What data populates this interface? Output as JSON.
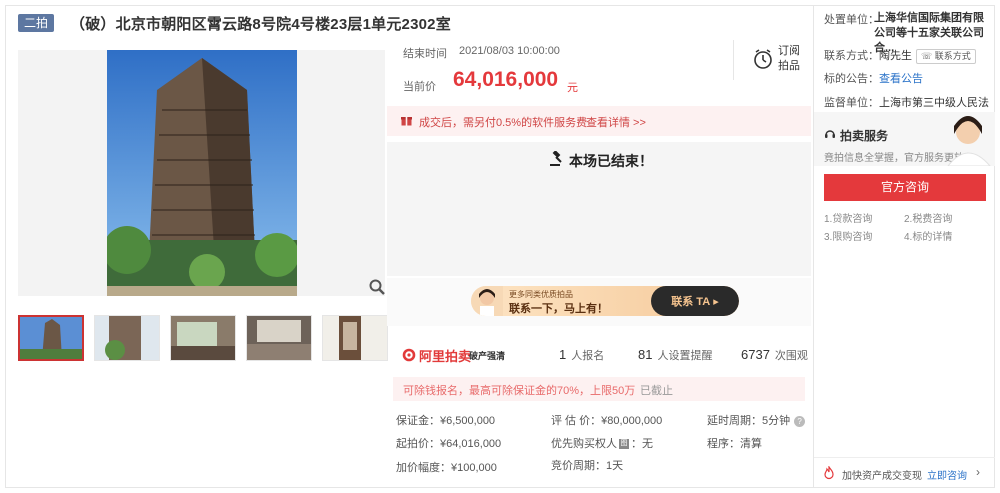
{
  "title": {
    "round_badge": "二拍",
    "text": "（破）北京市朝阳区霄云路8号院4号楼23层1单元2302室"
  },
  "auction": {
    "end_time_label": "结束时间",
    "end_time_value": "2021/08/03 10:00:00",
    "price_label": "当前价",
    "price_value": "64,016,000",
    "price_unit": "元",
    "subscribe_label": "订阅拍品",
    "fee_text": "成交后，需另付0.5%的软件服务费",
    "fee_link": "查看详情 >>",
    "status_text": "本场已结束！"
  },
  "banner": {
    "small_text": "更多同类优质拍品",
    "big_text": "联系一下，马上有！",
    "cta": "联系 TA"
  },
  "stats": {
    "brand": "阿里拍卖",
    "slogan": "破产强清",
    "signup_num": "1",
    "signup_label": "人报名",
    "remind_num": "81",
    "remind_label": "人设置提醒",
    "views_num": "6737",
    "views_label": "次围观",
    "deposit_text": "可除钱报名，最高可除保证金的70%，上限50万",
    "deposit_status": "已截止"
  },
  "details": {
    "deposit": "保证金：¥6,500,000",
    "appraisal": "评 估 价：¥80,000,000",
    "delay": "延时周期：5分钟",
    "start_price": "起拍价：¥64,016,000",
    "priority_prefix": "优先购买权人",
    "priority_icon": "图",
    "priority_value": "：无",
    "procedure": "程序：清算",
    "increment": "加价幅度：¥100,000",
    "bid_period": "竞价周期：1天"
  },
  "right": {
    "org_label": "处置单位：",
    "org_value": "上海华信国际集团有限公司等十五家关联公司合...",
    "contact_label": "联系方式：",
    "contact_name": "陶先生",
    "contact_btn": "联系方式",
    "notice_label": "标的公告：",
    "notice_link": "查看公告",
    "supervisor_label": "监督单位：",
    "supervisor_value": "上海市第三中级人民法院",
    "service_title": "拍卖服务",
    "service_sub": "竟拍信息全掌握，官方服务更放心",
    "consult_btn": "官方咨询",
    "svc1": "1.贷款咨询",
    "svc2": "2.税费咨询",
    "svc3": "3.限购咨询",
    "svc4": "4.标的详情",
    "footer_text": "加快资产成交变现",
    "footer_link": "立即咨询"
  },
  "colors": {
    "accent": "#e4393c",
    "badge": "#5d77a1",
    "link": "#2a72c8"
  },
  "icons": [
    "zoom-icon",
    "clock-icon",
    "gift-icon",
    "gavel-icon",
    "ali-logo-icon",
    "help-icon",
    "service-icon",
    "fire-icon",
    "chevron-right-icon"
  ]
}
